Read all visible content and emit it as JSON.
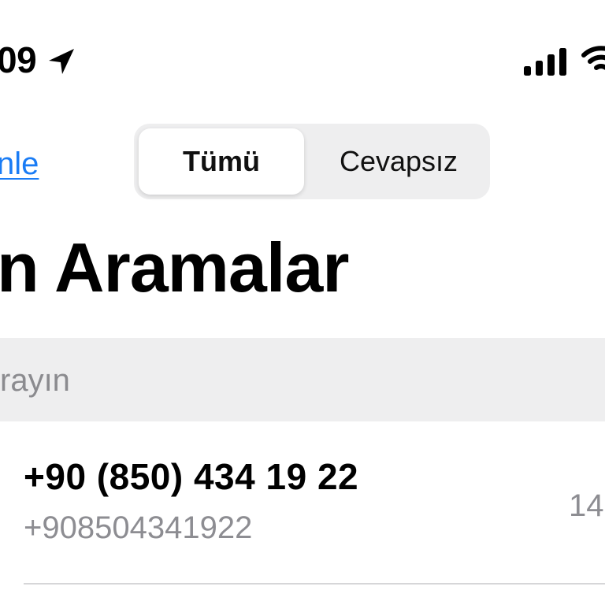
{
  "status_bar": {
    "time": "09",
    "location_icon": "location-arrow-icon",
    "signal_icon": "cellular-signal-icon",
    "wifi_icon": "wifi-icon"
  },
  "nav": {
    "edit_label": "nle",
    "segments": [
      {
        "label": "Tümü",
        "selected": true
      },
      {
        "label": "Cevapsız",
        "selected": false
      }
    ]
  },
  "title": "n Aramalar",
  "search": {
    "placeholder": "rayın"
  },
  "calls": [
    {
      "name": "+90 (850) 434 19 22",
      "detail": "+908504341922",
      "time": "14"
    }
  ],
  "colors": {
    "accent": "#1a7cf5",
    "secondary_text": "#8d8d92",
    "search_background": "#eeeeef"
  }
}
